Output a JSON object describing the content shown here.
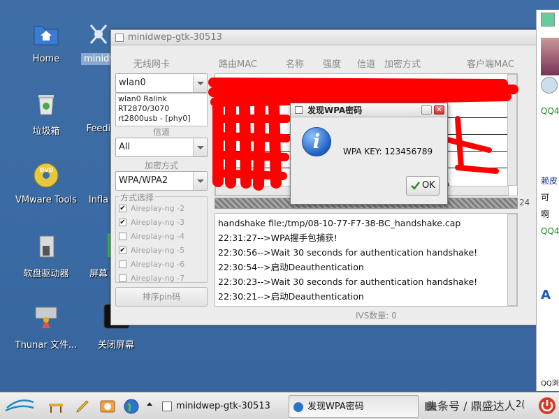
{
  "desktop": {
    "icons": [
      {
        "label": "Home"
      },
      {
        "label": "minidwep"
      },
      {
        "label": "垃圾箱"
      },
      {
        "label": "Feedi"
      },
      {
        "label": "VMware Tools"
      },
      {
        "label": "Infla"
      },
      {
        "label": "软盘驱动器"
      },
      {
        "label": "屏幕"
      },
      {
        "label": "Thunar 文件..."
      },
      {
        "label": "关闭屏幕"
      }
    ]
  },
  "main_window": {
    "title": "minidwep-gtk-30513",
    "columns": {
      "wireless_card": "无线网卡",
      "router_mac": "路由MAC",
      "name": "名称",
      "strength": "强度",
      "channel": "信道",
      "encryption": "加密方式",
      "client_mac": "客户端MAC"
    },
    "interface_value": "wlan0",
    "interface_info": "wlan0 Ralink RT2870/3070 rt2800usb - [phy0]",
    "channel_label": "信道",
    "channel_value": "All",
    "encryption_label": "加密方式",
    "encryption_value": "WPA/WPA2",
    "mode_legend": "方式选择",
    "modes": [
      {
        "label": "Aireplay-ng -2",
        "checked": true
      },
      {
        "label": "Aireplay-ng -3",
        "checked": true
      },
      {
        "label": "Aireplay-ng -4",
        "checked": false
      },
      {
        "label": "Aireplay-ng -5",
        "checked": true
      },
      {
        "label": "Aireplay-ng -6",
        "checked": false
      },
      {
        "label": "Aireplay-ng -7",
        "checked": false
      }
    ],
    "sort_pin_button": "排序pin码",
    "progress_value": "24",
    "ap_row_fragment": "A",
    "log_lines": [
      "handshake file:/tmp/08-10-77-F7-38-BC_handshake.cap",
      "22:31:27-->WPA握手包捕获!",
      "22:30:56-->Wait 30 seconds for authentication handshake!",
      "22:30:54-->启动Deauthentication",
      "22:30:23-->Wait 30 seconds for authentication handshake!",
      "22:30:21-->启动Deauthentication"
    ],
    "ivs_count": "IVS数量: 0"
  },
  "dialog": {
    "title": "发现WPA密码",
    "message": "WPA KEY: 123456789",
    "ok_label": "OK",
    "icon": "info-icon"
  },
  "qq_panel": {
    "text_1": "QQ4",
    "text_2": "赖皮",
    "text_3": "可",
    "text_4": "啊",
    "text_5": "QQ4",
    "text_6": "A",
    "text_7": "QQ浏"
  },
  "taskbar": {
    "tasks": [
      {
        "label": "minidwep-gtk-30513"
      },
      {
        "label": "发现WPA密码"
      }
    ],
    "clock_fragment": "2(",
    "watermark": "头条号 / 鼎盛达人"
  },
  "colors": {
    "desktop_bg": "#3f6ea6",
    "scribble_red": "#ff0000",
    "info_blue": "#1f5fbf"
  }
}
